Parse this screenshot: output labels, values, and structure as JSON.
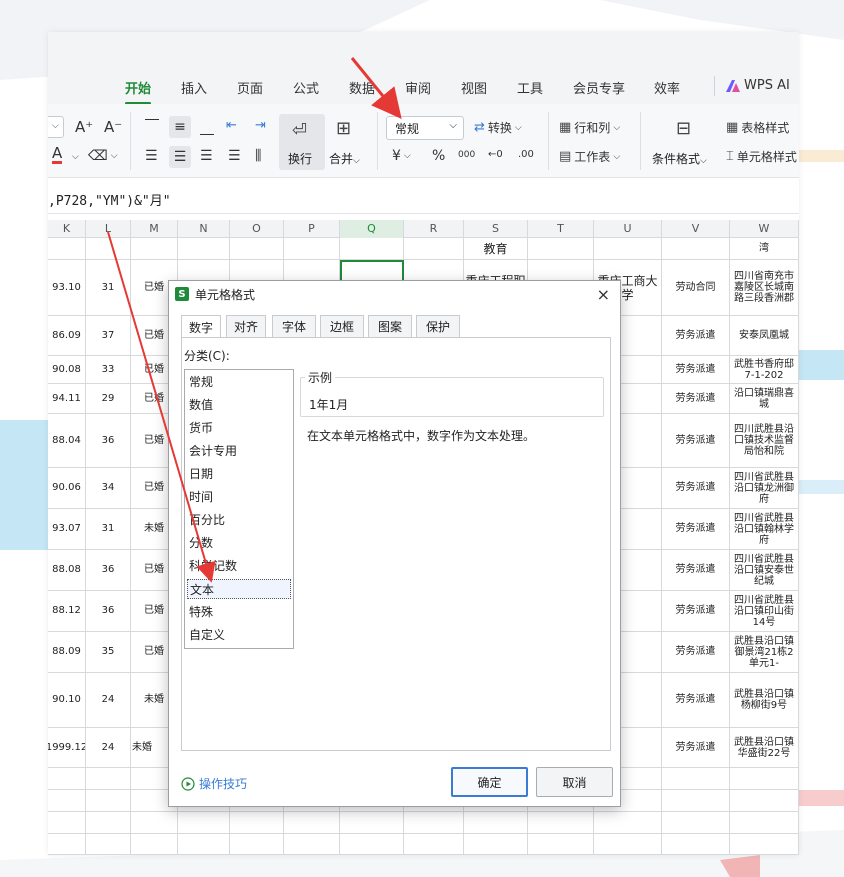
{
  "ribbon": {
    "tabs": [
      "开始",
      "插入",
      "页面",
      "公式",
      "数据",
      "审阅",
      "视图",
      "工具",
      "会员专享",
      "效率"
    ],
    "active_tab": "开始",
    "ai_label": "WPS AI"
  },
  "toolbar": {
    "font_increase": "A⁺",
    "font_decrease": "A⁻",
    "wrap_label": "换行",
    "merge_label": "合并",
    "number_format_value": "常规",
    "convert_label": "转换",
    "rows_cols_label": "行和列",
    "worksheet_label": "工作表",
    "cond_format_label": "条件格式",
    "table_style_label": "表格样式",
    "cell_style_label": "单元格样式",
    "currency_symbol": "¥",
    "percent_symbol": "%",
    "thousands_symbol": "000"
  },
  "formula_bar": {
    "text": ",P728,\"YM\")&\"月\""
  },
  "columns": [
    "K",
    "L",
    "M",
    "N",
    "O",
    "P",
    "Q",
    "R",
    "S",
    "T",
    "U",
    "V",
    "W"
  ],
  "selected_column": "Q",
  "rows": [
    {
      "k": "",
      "l": "",
      "m": "",
      "s": "教育",
      "v": "",
      "w": "湾"
    },
    {
      "k": "93.10",
      "l": "31",
      "m": "已婚",
      "s": "重庆工程职业技术",
      "u": "重庆工商大学",
      "v": "劳动合同",
      "w": "四川省南充市嘉陵区长城南路三段香洲郡"
    },
    {
      "k": "86.09",
      "l": "37",
      "m": "已婚",
      "v": "劳务派遣",
      "w": "安泰凤凰城"
    },
    {
      "k": "90.08",
      "l": "33",
      "m": "已婚",
      "v": "劳务派遣",
      "w": "武胜书香府邸7-1-202"
    },
    {
      "k": "94.11",
      "l": "29",
      "m": "已婚",
      "v": "劳务派遣",
      "w": "沿口镇瑞鼎喜城"
    },
    {
      "k": "88.04",
      "l": "36",
      "m": "已婚",
      "v": "劳务派遣",
      "w": "四川武胜县沿口镇技术监督局怡和院"
    },
    {
      "k": "90.06",
      "l": "34",
      "m": "已婚",
      "v": "劳务派遣",
      "w": "四川省武胜县沿口镇龙洲御府"
    },
    {
      "k": "93.07",
      "l": "31",
      "m": "未婚",
      "v": "劳务派遣",
      "w": "四川省武胜县沿口镇翰林学府"
    },
    {
      "k": "88.08",
      "l": "36",
      "m": "已婚",
      "v": "劳务派遣",
      "w": "四川省武胜县沿口镇安泰世纪城"
    },
    {
      "k": "88.12",
      "l": "36",
      "m": "已婚",
      "v": "劳务派遣",
      "w": "四川省武胜县沿口镇印山街14号"
    },
    {
      "k": "88.09",
      "l": "35",
      "m": "已婚",
      "v": "劳务派遣",
      "w": "武胜县沿口镇御景湾21栋2单元1-"
    },
    {
      "k": "90.10",
      "l": "24",
      "m": "未婚",
      "v": "劳务派遣",
      "w": "武胜县沿口镇杨柳街9号"
    },
    {
      "k": "1999.12",
      "l": "24",
      "m": "未婚",
      "v": "劳务派遣",
      "w": "武胜县沿口镇华盛街22号"
    }
  ],
  "dialog": {
    "title": "单元格格式",
    "tabs": [
      "数字",
      "对齐",
      "字体",
      "边框",
      "图案",
      "保护"
    ],
    "active_tab": "数字",
    "category_label": "分类(C):",
    "categories": [
      "常规",
      "数值",
      "货币",
      "会计专用",
      "日期",
      "时间",
      "百分比",
      "分数",
      "科学记数",
      "文本",
      "特殊",
      "自定义"
    ],
    "selected_category": "文本",
    "sample_label": "示例",
    "sample_value": "1年1月",
    "description": "在文本单元格格式中，数字作为文本处理。",
    "tips_label": "操作技巧",
    "ok_label": "确定",
    "cancel_label": "取消",
    "close_glyph": "×",
    "icon_letter": "S"
  },
  "colors": {
    "accent_green": "#1f8a3a",
    "annotation_red": "#e53935",
    "link_blue": "#3a7bd5"
  }
}
